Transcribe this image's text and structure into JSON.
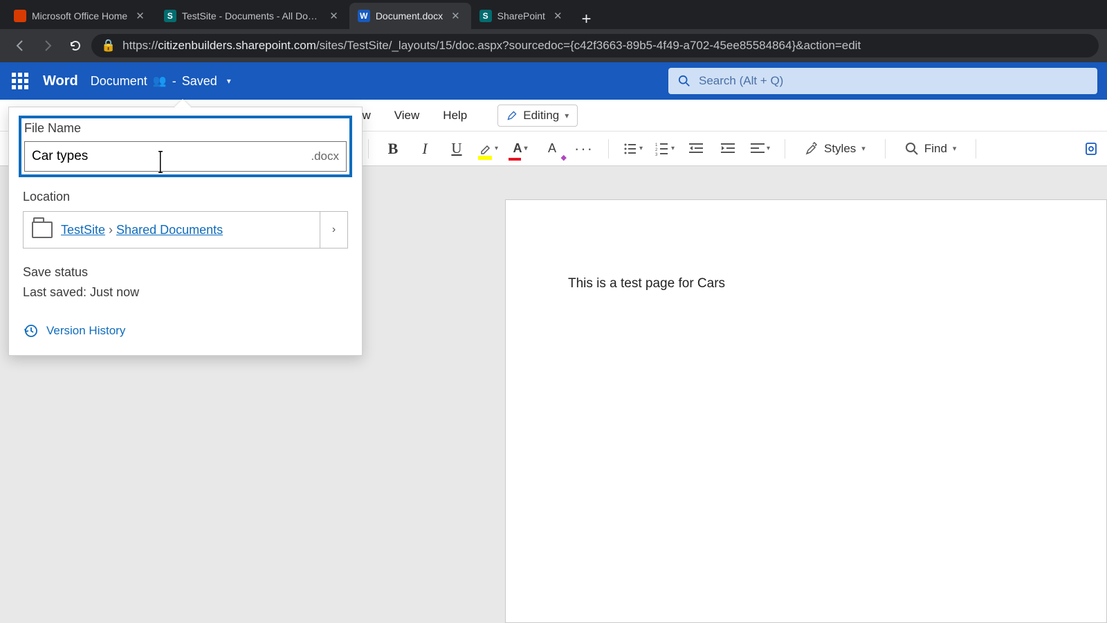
{
  "browser": {
    "tabs": [
      {
        "title": "Microsoft Office Home",
        "favicon_bg": "#d83b01",
        "favicon_text": "",
        "active": false
      },
      {
        "title": "TestSite - Documents - All Docum",
        "favicon_bg": "#036c70",
        "favicon_text": "S",
        "active": false
      },
      {
        "title": "Document.docx",
        "favicon_bg": "#185abd",
        "favicon_text": "W",
        "active": true
      },
      {
        "title": "SharePoint",
        "favicon_bg": "#036c70",
        "favicon_text": "S",
        "active": false
      }
    ],
    "url_host": "citizenbuilders.sharepoint.com",
    "url_prefix": "https://",
    "url_path": "/sites/TestSite/_layouts/15/doc.aspx?sourcedoc={c42f3663-89b5-4f49-a702-45ee85584864}&action=edit"
  },
  "app": {
    "name": "Word",
    "doc_title": "Document",
    "save_state": "Saved",
    "search_placeholder": "Search (Alt + Q)"
  },
  "ribbon": {
    "tabs": {
      "review": "Review",
      "view": "View",
      "help": "Help"
    },
    "editing_label": "Editing",
    "styles_label": "Styles",
    "find_label": "Find"
  },
  "callout": {
    "file_name_label": "File Name",
    "file_name_value": "Car types",
    "file_ext": ".docx",
    "location_label": "Location",
    "loc_site": "TestSite",
    "loc_lib": "Shared Documents",
    "save_status_label": "Save status",
    "save_status_value": "Last saved: Just now",
    "version_history_label": "Version History"
  },
  "document": {
    "body_text": "This is a test page for Cars"
  }
}
